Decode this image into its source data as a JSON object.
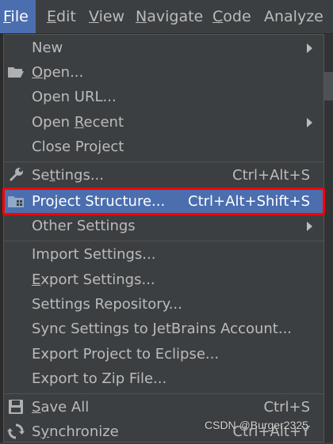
{
  "menubar": {
    "file": {
      "first": "F",
      "rest": "ile"
    },
    "edit": {
      "first": "E",
      "rest": "dit"
    },
    "view": {
      "first": "V",
      "rest": "iew"
    },
    "navigate": {
      "first": "N",
      "rest": "avigate"
    },
    "code": {
      "first": "C",
      "rest": "ode"
    },
    "analyze": {
      "label": "Analyze"
    }
  },
  "menu": {
    "new": {
      "label": "New"
    },
    "open": {
      "u": "O",
      "rest": "pen..."
    },
    "open_url": {
      "label": "Open URL..."
    },
    "open_recent": {
      "pre": "Open ",
      "u": "R",
      "rest": "ecent"
    },
    "close_project": {
      "label": "Close Project"
    },
    "settings": {
      "pre": "Se",
      "u": "t",
      "rest": "tings...",
      "shortcut": "Ctrl+Alt+S"
    },
    "project_structure": {
      "label": "Project Structure...",
      "shortcut": "Ctrl+Alt+Shift+S"
    },
    "other_settings": {
      "label": "Other Settings"
    },
    "import_settings": {
      "label": "Import Settings..."
    },
    "export_settings": {
      "u": "E",
      "rest": "xport Settings..."
    },
    "settings_repository": {
      "label": "Settings Repository..."
    },
    "sync_settings": {
      "label": "Sync Settings to JetBrains Account..."
    },
    "export_eclipse": {
      "label": "Export Project to Eclipse..."
    },
    "export_zip": {
      "label": "Export to Zip File..."
    },
    "save_all": {
      "u": "S",
      "rest": "ave All",
      "shortcut": "Ctrl+S"
    },
    "synchronize": {
      "pre": "S",
      "u": "y",
      "rest": "nchronize",
      "shortcut": "Ctrl+Alt+Y"
    }
  },
  "watermark": "CSDN @Burger2325",
  "colors": {
    "menu_bg": "#3c3f41",
    "selection": "#4b6eaf",
    "highlight_box": "#ff0000",
    "text": "#bbbbbb"
  },
  "icons": {
    "open": "folder-open-icon",
    "settings": "wrench-icon",
    "project_structure": "project-structure-icon",
    "save_all": "save-icon",
    "synchronize": "sync-icon"
  }
}
